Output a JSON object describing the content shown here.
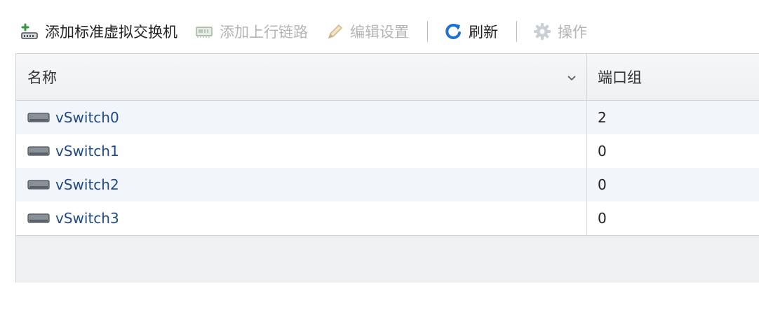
{
  "toolbar": {
    "add_switch_label": "添加标准虚拟交换机",
    "add_uplink_label": "添加上行链路",
    "edit_settings_label": "编辑设置",
    "refresh_label": "刷新",
    "actions_label": "操作",
    "icons": {
      "add_switch": "add-network-icon",
      "add_uplink": "network-card-icon",
      "edit_settings": "pencil-icon",
      "refresh": "refresh-icon",
      "actions": "gear-icon"
    }
  },
  "table": {
    "columns": [
      "名称",
      "端口组"
    ],
    "rows": [
      {
        "name": "vSwitch0",
        "port_groups": "2"
      },
      {
        "name": "vSwitch1",
        "port_groups": "0"
      },
      {
        "name": "vSwitch2",
        "port_groups": "0"
      },
      {
        "name": "vSwitch3",
        "port_groups": "0"
      }
    ],
    "row_icon": "vswitch-icon"
  },
  "colors": {
    "link": "#1f4a8a",
    "refresh_blue": "#1e6fd6",
    "disabled_text": "#b4b4b4",
    "row_alt": "#f2f6fb"
  }
}
